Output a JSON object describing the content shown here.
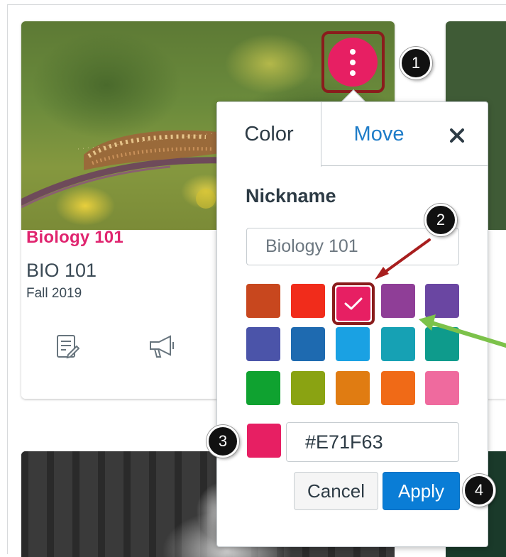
{
  "course_card": {
    "name": "Biology 101",
    "code": "BIO 101",
    "term": "Fall 2019",
    "icons": [
      "assignments-icon",
      "announcements-icon"
    ]
  },
  "kebab_menu": {
    "icon": "kebab-icon"
  },
  "popover": {
    "tabs": [
      {
        "label": "Color",
        "selected": true
      },
      {
        "label": "Move",
        "selected": false
      }
    ],
    "close_icon": "close-icon",
    "nickname_label": "Nickname",
    "nickname_placeholder": "Biology 101",
    "swatches": [
      [
        "#c8471e",
        "#f12c1b",
        "#e71f63",
        "#8f3e97",
        "#6a46a2"
      ],
      [
        "#4b54a9",
        "#1e6ab0",
        "#1aa1e3",
        "#16a1b4",
        "#0e9b8c"
      ],
      [
        "#0fa230",
        "#8aa312",
        "#e07c12",
        "#f06a17",
        "#ef6a9e"
      ]
    ],
    "selected_swatch": "#e71f63",
    "hex_value": "#E71F63",
    "cancel_label": "Cancel",
    "apply_label": "Apply"
  },
  "callouts": [
    "1",
    "2",
    "3",
    "4"
  ],
  "annotation_colors": {
    "highlight": "#8a1c1c",
    "green_arrow": "#7cc24a",
    "red_arrow": "#a81e1e"
  }
}
